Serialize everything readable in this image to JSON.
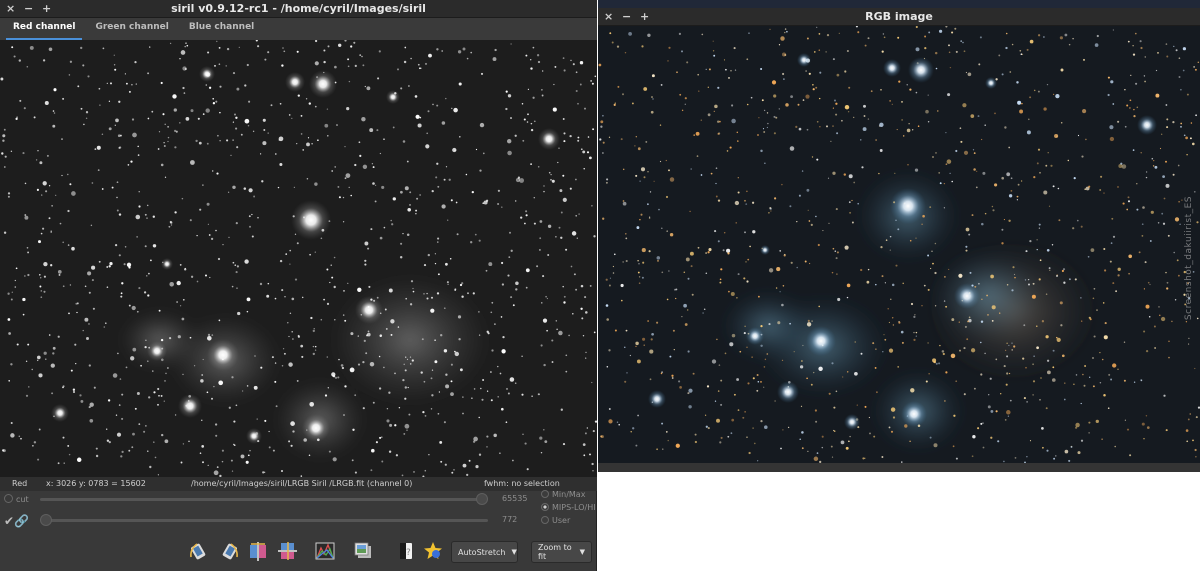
{
  "main_window": {
    "title": "siril v0.9.12-rc1 - /home/cyril/Images/siril",
    "window_buttons": [
      "×",
      "−",
      "+"
    ],
    "tabs": [
      {
        "label": "Red channel",
        "active": true
      },
      {
        "label": "Green channel",
        "active": false
      },
      {
        "label": "Blue channel",
        "active": false
      }
    ],
    "status": {
      "channel": "Red",
      "coords": "x: 3026 y: 0783 = 15602",
      "file": "/home/cyril/Images/siril/LRGB Siril /LRGB.fit (channel 0)",
      "fwhm": "fwhm: no selection"
    },
    "controls": {
      "cut_label": "cut",
      "high_value": "65535",
      "low_value": "772",
      "high_level": 1.0,
      "low_level": 0.0,
      "display_modes": [
        {
          "label": "Min/Max",
          "selected": false
        },
        {
          "label": "MIPS-LO/HI",
          "selected": true
        },
        {
          "label": "User",
          "selected": false
        }
      ]
    },
    "toolbar": {
      "icons": [
        "rotate-left-icon",
        "rotate-right-icon",
        "mirror-x-icon",
        "mirror-y-icon",
        "histogram-icon",
        "image-layers-icon",
        "negative-view-icon",
        "color-map-icon"
      ],
      "stretch_dropdown": "AutoStretch",
      "zoom_dropdown": "Zoom to fit"
    }
  },
  "rgb_window": {
    "title": "RGB image",
    "window_buttons": [
      "×",
      "−",
      "+"
    ],
    "watermark": "Screenshot_dakuiirist_ES"
  },
  "colors": {
    "window_bg": "#393939",
    "titlebar_bg": "#2b2b2b",
    "tab_active_underline": "#4a90d9",
    "text": "#e8e8e8"
  }
}
